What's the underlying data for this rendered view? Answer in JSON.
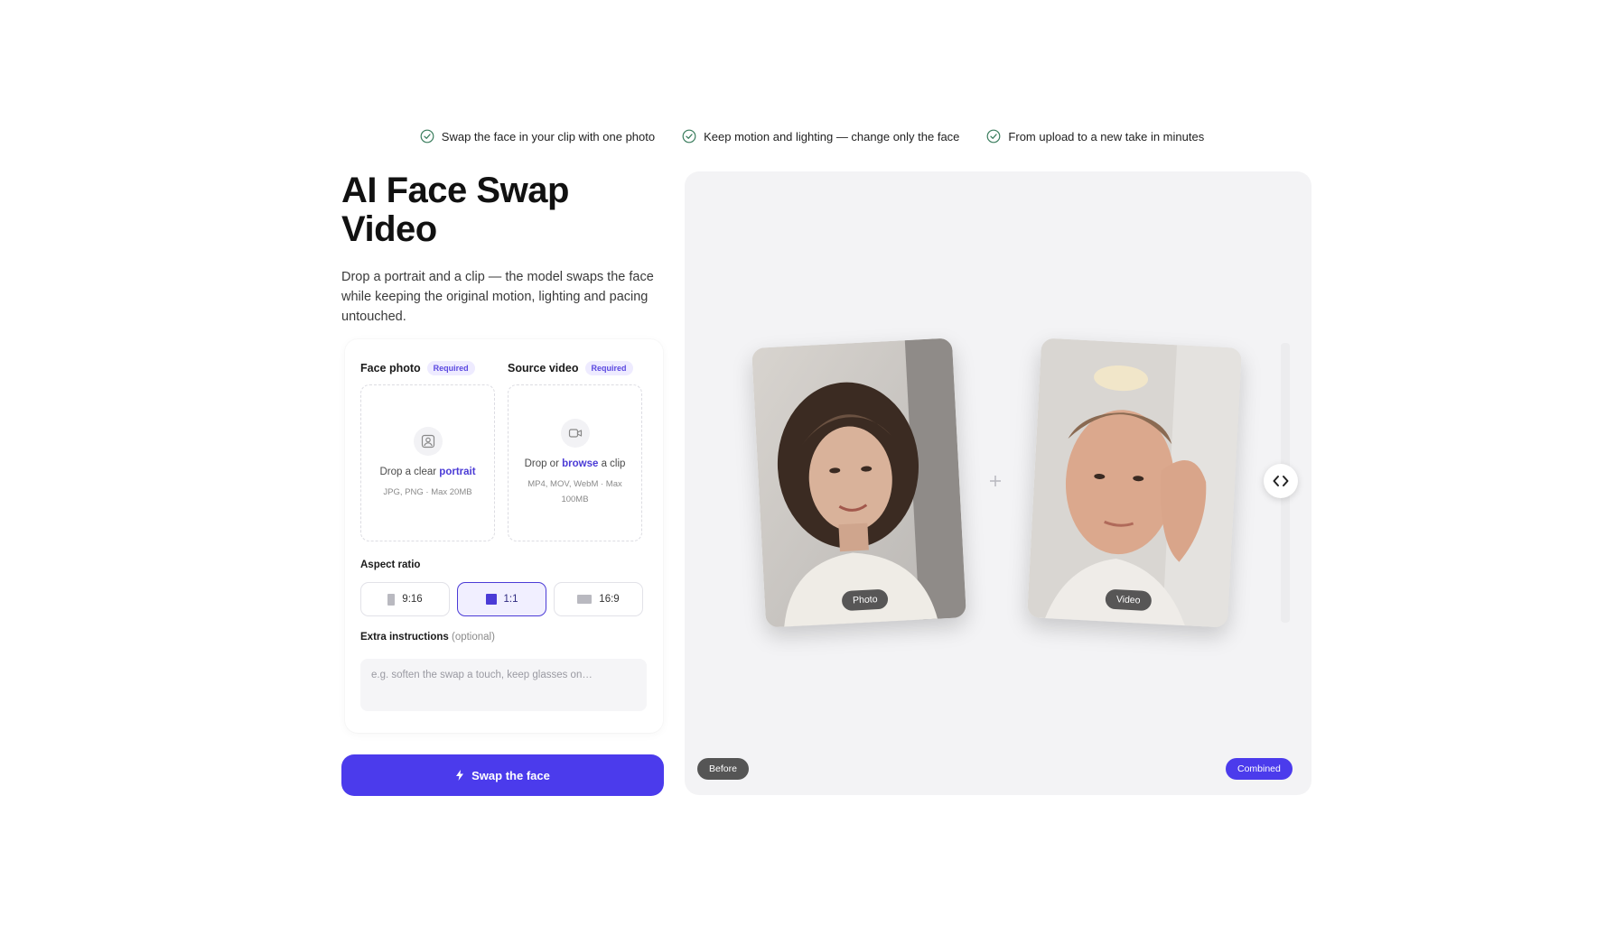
{
  "features": [
    "Swap the face in your clip with one photo",
    "Keep motion and lighting — change only the face",
    "From upload to a new take in minutes"
  ],
  "hero": {
    "title_line1": "AI Face Swap",
    "title_line2": "Video",
    "description": "Drop a portrait and a clip — the model swaps the face while keeping the original motion, lighting and pacing untouched."
  },
  "form": {
    "face_photo": {
      "label": "Face photo",
      "badge": "Required",
      "drop_prefix": "Drop a clear ",
      "drop_accent": "portrait",
      "formats": "JPG, PNG · Max 20MB"
    },
    "source_video": {
      "label": "Source video",
      "badge": "Required",
      "drop_prefix": "Drop or ",
      "drop_accent": "browse",
      "drop_suffix": " a clip",
      "formats": "MP4, MOV, WebM · Max 100MB"
    },
    "aspect_ratio": {
      "label": "Aspect ratio",
      "options": [
        "9:16",
        "1:1",
        "16:9"
      ],
      "selected": "1:1"
    },
    "extra": {
      "label": "Extra instructions",
      "optional": "(optional)",
      "placeholder": "e.g. soften the swap a touch, keep glasses on…"
    },
    "submit_label": "Swap the face"
  },
  "preview": {
    "photo_tag": "Photo",
    "video_tag": "Video",
    "before_tag": "Before",
    "combined_tag": "Combined"
  },
  "colors": {
    "accent": "#4b3bec",
    "badge_bg": "#eeebff",
    "panel_bg": "#f3f3f5"
  },
  "icons": [
    "check-circle-icon",
    "portrait-icon",
    "video-camera-icon",
    "bolt-icon",
    "plus-icon",
    "swap-arrows-icon"
  ]
}
